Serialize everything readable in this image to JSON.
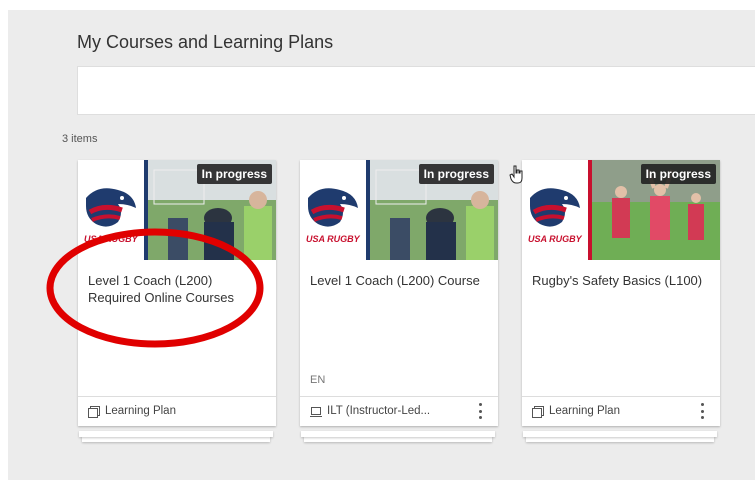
{
  "page": {
    "title": "My Courses and Learning Plans",
    "items_count": "3 items"
  },
  "search": {
    "placeholder": ""
  },
  "cards": [
    {
      "badge": "In progress",
      "title": "Level 1 Coach (L200) Required Online Courses",
      "lang": "",
      "type_label": "Learning Plan",
      "type_icon": "learning-plan-icon",
      "logo_text": "USA RUGBY",
      "bar_color": "#1f3b6e"
    },
    {
      "badge": "In progress",
      "title": "Level 1 Coach (L200) Course",
      "lang": "EN",
      "type_label": "ILT (Instructor-Led...",
      "type_icon": "ilt-icon",
      "logo_text": "USA RUGBY",
      "bar_color": "#1f3b6e"
    },
    {
      "badge": "In progress",
      "title": "Rugby's Safety Basics (L100)",
      "lang": "",
      "type_label": "Learning Plan",
      "type_icon": "learning-plan-icon",
      "logo_text": "USA RUGBY",
      "bar_color": "#c8102e"
    }
  ],
  "colors": {
    "annotation": "#e00000",
    "brand_red": "#c8102e",
    "brand_navy": "#1f3b6e"
  }
}
